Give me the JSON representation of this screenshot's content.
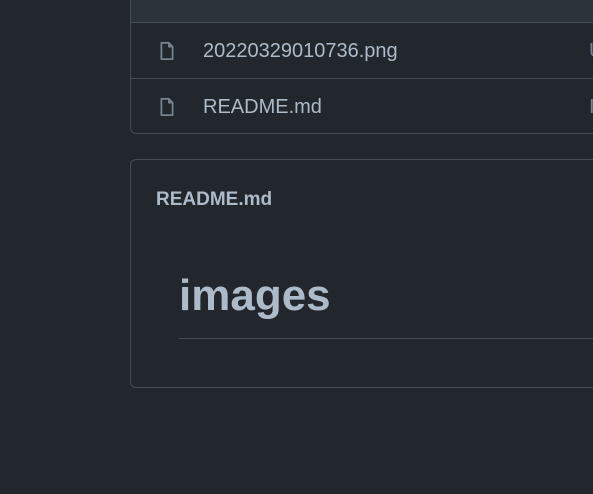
{
  "files": [
    {
      "name": "20220329010736.png",
      "meta": "U",
      "icon": "file-icon"
    },
    {
      "name": "README.md",
      "meta": "I",
      "icon": "file-icon"
    }
  ],
  "readme": {
    "title": "README.md",
    "heading": "images"
  },
  "colors": {
    "background": "#22272e",
    "border": "#444c56",
    "text": "#adbac7",
    "muted": "#768390"
  }
}
